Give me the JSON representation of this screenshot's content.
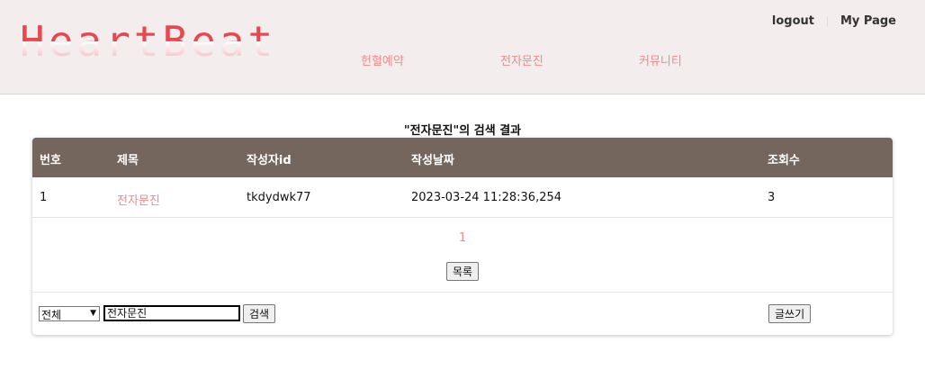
{
  "header": {
    "logo": "HeartBeat",
    "nav": [
      "헌혈예약",
      "전자문진",
      "커뮤니티"
    ],
    "logout": "logout",
    "mypage": "My Page"
  },
  "result_title": "\"전자문진\"의 검색 결과",
  "table": {
    "headers": [
      "번호",
      "제목",
      "작성자id",
      "작성날짜",
      "조회수"
    ],
    "rows": [
      {
        "num": "1",
        "title": "전자문진",
        "author": "tkdydwk77",
        "date": "2023-03-24 11:28:36,254",
        "views": "3"
      }
    ]
  },
  "pager": {
    "current": "1"
  },
  "list_button": "목록",
  "search": {
    "scope": "전체",
    "query": "전자문진",
    "button": "검색"
  },
  "write_button": "글쓰기",
  "colors": {
    "accent": "#ef8a8a",
    "table_header": "#74665c",
    "header_bg": "#f3eded",
    "logo": "#e8484d"
  }
}
